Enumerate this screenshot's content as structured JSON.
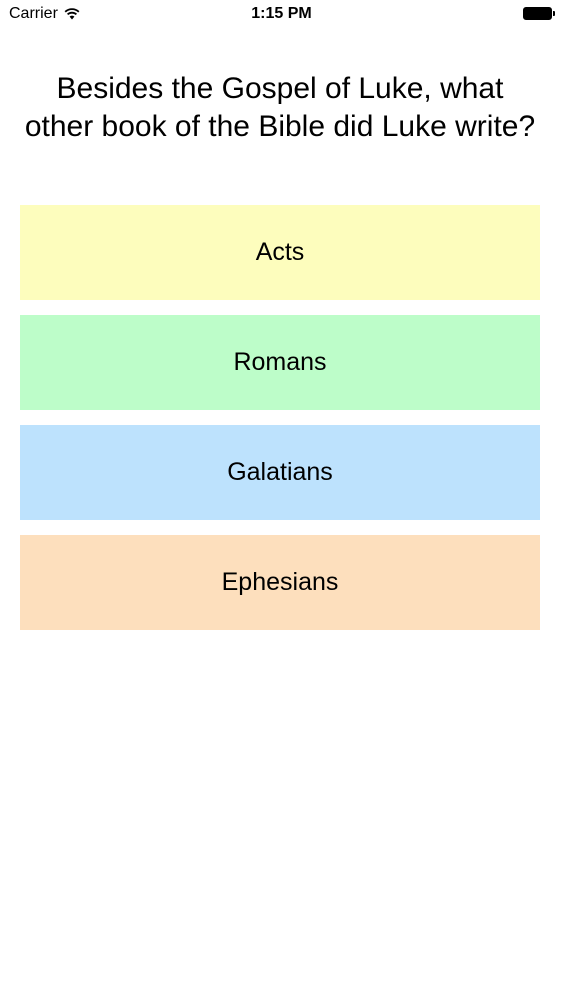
{
  "status_bar": {
    "carrier": "Carrier",
    "time": "1:15 PM",
    "icons": [
      "wifi-icon",
      "battery-icon"
    ]
  },
  "quiz": {
    "question": "Besides the Gospel of Luke, what other book of the Bible did Luke write?",
    "answers": [
      {
        "label": "Acts",
        "color": "#fdfdbd"
      },
      {
        "label": "Romans",
        "color": "#bdfdc9"
      },
      {
        "label": "Galatians",
        "color": "#bde2fd"
      },
      {
        "label": "Ephesians",
        "color": "#fddfbd"
      }
    ]
  }
}
